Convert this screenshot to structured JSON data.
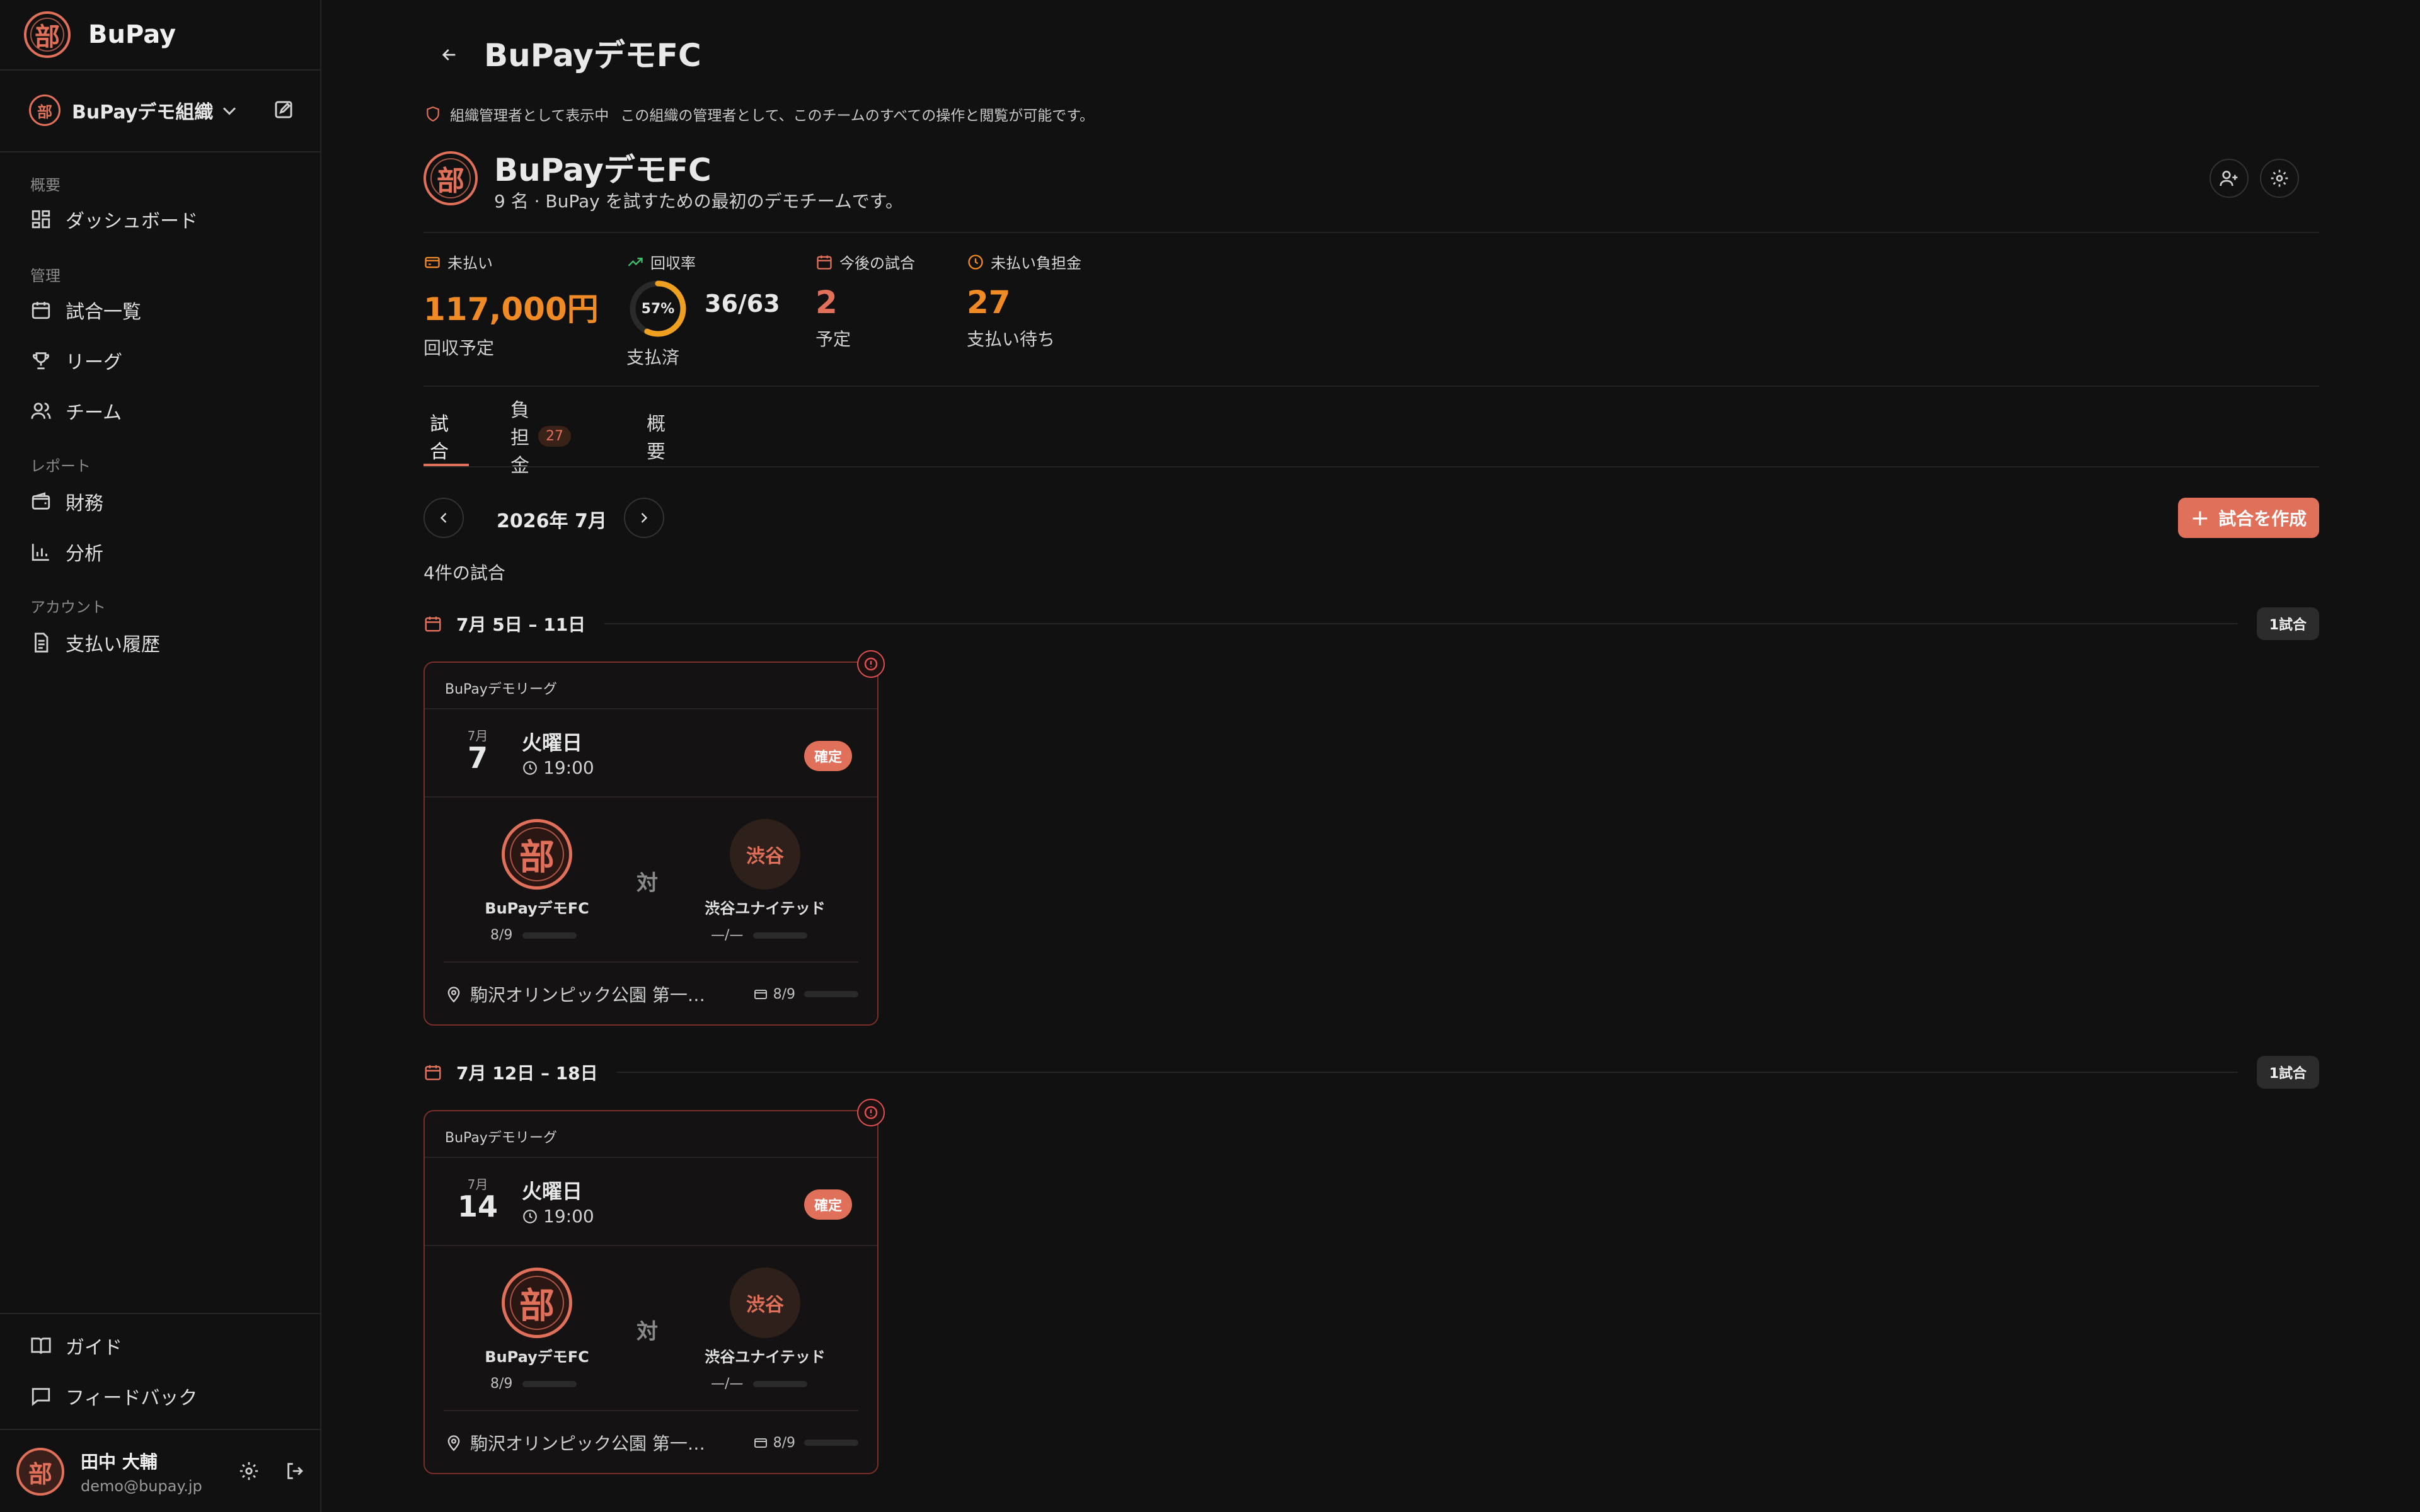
{
  "app": {
    "name": "BuPay",
    "logo_char": "部"
  },
  "org": {
    "name": "BuPayデモ組織"
  },
  "nav": {
    "sections": {
      "overview": "概要",
      "manage": "管理",
      "reports": "レポート",
      "account": "アカウント"
    },
    "items": {
      "dashboard": "ダッシュボード",
      "matches": "試合一覧",
      "league": "リーグ",
      "team": "チーム",
      "finance": "財務",
      "analytics": "分析",
      "payment_history": "支払い履歴",
      "guide": "ガイド",
      "feedback": "フィードバック"
    }
  },
  "user": {
    "name": "田中 大輔",
    "email": "demo@bupay.jp"
  },
  "page": {
    "title": "BuPayデモFC",
    "admin_label": "組織管理者として表示中",
    "admin_message": "この組織の管理者として、このチームのすべての操作と閲覧が可能です。",
    "team_name": "BuPayデモFC",
    "team_desc": "9 名 · BuPay を試すための最初のデモチームです。"
  },
  "stats": {
    "unpaid": {
      "label": "未払い",
      "value": "117,000円",
      "sub": "回収予定"
    },
    "collection": {
      "label": "回収率",
      "percent_text": "57%",
      "percent": 0.57,
      "value": "36/63",
      "sub": "支払済"
    },
    "upcoming": {
      "label": "今後の試合",
      "value": "2",
      "sub": "予定"
    },
    "pending": {
      "label": "未払い負担金",
      "value": "27",
      "sub": "支払い待ち"
    }
  },
  "tabs": {
    "matches": "試合",
    "fees": "負担金",
    "fees_count": "27",
    "overview": "概要"
  },
  "calendar": {
    "month": "2026年 7月",
    "count": "4件の試合",
    "create": "試合を作成"
  },
  "weeks": [
    {
      "label": "7月 5日 – 11日",
      "pill": "1試合",
      "match": {
        "league": "BuPayデモリーグ",
        "month": "7月",
        "day": "7",
        "dow": "火曜日",
        "time": "19:00",
        "status": "確定",
        "home": {
          "name": "BuPayデモFC",
          "crest": "部",
          "ratio": "8/9",
          "fill": 0.89
        },
        "vs": "対",
        "away": {
          "name": "渋谷ユナイテッド",
          "crest": "渋谷",
          "ratio": "—/—",
          "fill": 0
        },
        "venue": "駒沢オリンピック公園 第一球技場",
        "paid": "8/9",
        "paid_fill": 0.89
      }
    },
    {
      "label": "7月 12日 – 18日",
      "pill": "1試合",
      "match": {
        "league": "BuPayデモリーグ",
        "month": "7月",
        "day": "14",
        "dow": "火曜日",
        "time": "19:00",
        "status": "確定",
        "home": {
          "name": "BuPayデモFC",
          "crest": "部",
          "ratio": "8/9",
          "fill": 0.89
        },
        "vs": "対",
        "away": {
          "name": "渋谷ユナイテッド",
          "crest": "渋谷",
          "ratio": "—/—",
          "fill": 0
        },
        "venue": "駒沢オリンピック公園 第一球技場",
        "paid": "8/9",
        "paid_fill": 0.89
      }
    }
  ],
  "colors": {
    "accent": "#e0705a",
    "orange": "#f08a24",
    "green": "#3fbf6a",
    "bg": "#111111"
  }
}
